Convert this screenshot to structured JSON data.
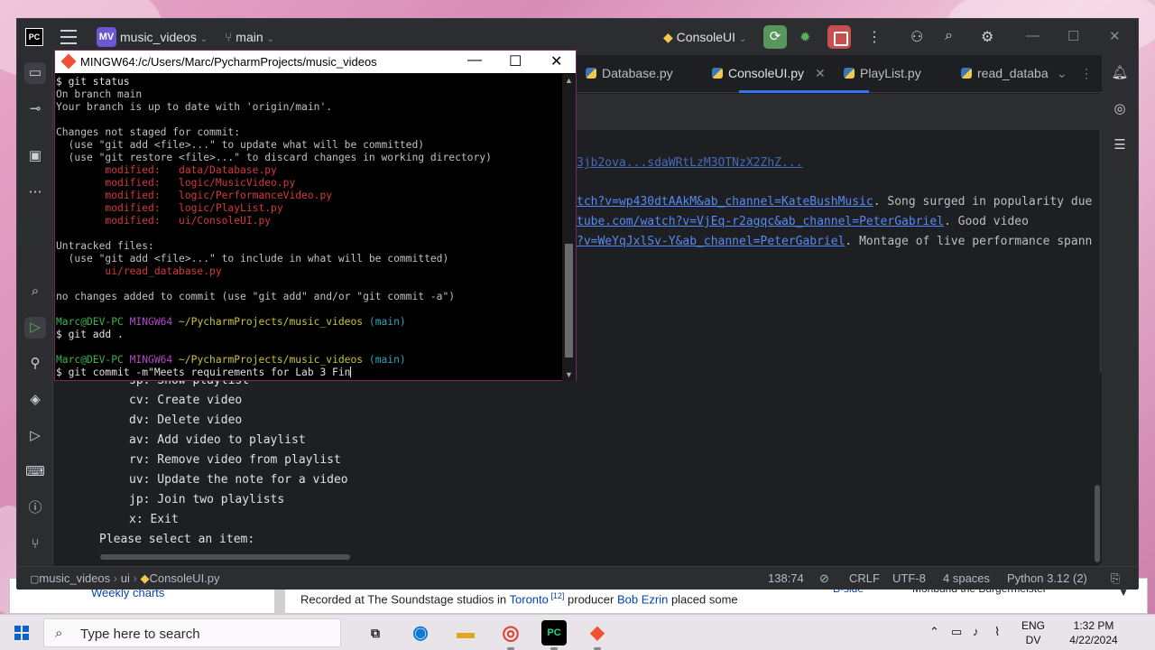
{
  "browser": {
    "weekly_charts": "Weekly charts",
    "recorded_text_1": "Recorded at The Soundstage studios in ",
    "toronto": "Toronto",
    "ref": " [12]",
    "recorded_text_2": " producer ",
    "bob_ezrin": "Bob Ezrin",
    "recorded_text_3": " placed some",
    "bside": "B-side",
    "bside_value": "Moribund the Burgermeister"
  },
  "ide": {
    "logo": "PC",
    "project_badge": "MV",
    "project_name": "music_videos",
    "branch": "main",
    "run_config": "ConsoleUI",
    "tabs": [
      {
        "label": "Database.py"
      },
      {
        "label": "ConsoleUI.py",
        "active": true
      },
      {
        "label": "PlayList.py"
      },
      {
        "label": "read_databa"
      }
    ],
    "editor_lines": [
      {
        "pre": "",
        "url": "3jb2ova...sdaWRtLzM3OTNzX2ZhZ...",
        "post": ""
      },
      {
        "pre": "",
        "url": "tch?v=wp430dtAAkM&ab_channel=KateBushMusic",
        "post": ". Song surged in popularity due"
      },
      {
        "pre": "",
        "url": "tube.com/watch?v=VjEq-r2agqc&ab_channel=PeterGabriel",
        "post": ". Good video"
      },
      {
        "pre": "",
        "url": "?v=WeYqJxlSv-Y&ab_channel=PeterGabriel",
        "post": ". Montage of live performance spann"
      }
    ],
    "console_menu": [
      "sp: Show playlist",
      "cv: Create video",
      "dv: Delete video",
      "av: Add video to playlist",
      "rv: Remove video from playlist",
      "uv: Update the note for a video",
      "jp: Join two playlists",
      "x: Exit"
    ],
    "console_prompt": "Please select an item:",
    "status": {
      "breadcrumb_project": "music_videos",
      "breadcrumb_folder": "ui",
      "breadcrumb_file": "ConsoleUI.py",
      "position": "138:74",
      "line_ending": "CRLF",
      "encoding": "UTF-8",
      "indent": "4 spaces",
      "interpreter": "Python 3.12 (2)"
    }
  },
  "terminal": {
    "title": "MINGW64:/c/Users/Marc/PycharmProjects/music_videos",
    "lines": [
      {
        "segs": [
          {
            "c": "wht",
            "t": "$ git status"
          }
        ]
      },
      {
        "segs": [
          {
            "c": "",
            "t": "On branch main"
          }
        ]
      },
      {
        "segs": [
          {
            "c": "",
            "t": "Your branch is up to date with 'origin/main'."
          }
        ]
      },
      {
        "segs": [
          {
            "c": "",
            "t": ""
          }
        ]
      },
      {
        "segs": [
          {
            "c": "",
            "t": "Changes not staged for commit:"
          }
        ]
      },
      {
        "segs": [
          {
            "c": "",
            "t": "  (use \"git add <file>...\" to update what will be committed)"
          }
        ]
      },
      {
        "segs": [
          {
            "c": "",
            "t": "  (use \"git restore <file>...\" to discard changes in working directory)"
          }
        ]
      },
      {
        "segs": [
          {
            "c": "red",
            "t": "        modified:   data/Database.py"
          }
        ]
      },
      {
        "segs": [
          {
            "c": "red",
            "t": "        modified:   logic/MusicVideo.py"
          }
        ]
      },
      {
        "segs": [
          {
            "c": "red",
            "t": "        modified:   logic/PerformanceVideo.py"
          }
        ]
      },
      {
        "segs": [
          {
            "c": "red",
            "t": "        modified:   logic/PlayList.py"
          }
        ]
      },
      {
        "segs": [
          {
            "c": "red",
            "t": "        modified:   ui/ConsoleUI.py"
          }
        ]
      },
      {
        "segs": [
          {
            "c": "",
            "t": ""
          }
        ]
      },
      {
        "segs": [
          {
            "c": "",
            "t": "Untracked files:"
          }
        ]
      },
      {
        "segs": [
          {
            "c": "",
            "t": "  (use \"git add <file>...\" to include in what will be committed)"
          }
        ]
      },
      {
        "segs": [
          {
            "c": "red",
            "t": "        ui/read_database.py"
          }
        ]
      },
      {
        "segs": [
          {
            "c": "",
            "t": ""
          }
        ]
      },
      {
        "segs": [
          {
            "c": "",
            "t": "no changes added to commit (use \"git add\" and/or \"git commit -a\")"
          }
        ]
      },
      {
        "segs": [
          {
            "c": "",
            "t": ""
          }
        ]
      },
      {
        "segs": [
          {
            "c": "grn",
            "t": "Marc@DEV-PC "
          },
          {
            "c": "mag",
            "t": "MINGW64 "
          },
          {
            "c": "yel",
            "t": "~/PycharmProjects/music_videos "
          },
          {
            "c": "cyn",
            "t": "(main)"
          }
        ]
      },
      {
        "segs": [
          {
            "c": "wht",
            "t": "$ git add ."
          }
        ]
      },
      {
        "segs": [
          {
            "c": "",
            "t": ""
          }
        ]
      },
      {
        "segs": [
          {
            "c": "grn",
            "t": "Marc@DEV-PC "
          },
          {
            "c": "mag",
            "t": "MINGW64 "
          },
          {
            "c": "yel",
            "t": "~/PycharmProjects/music_videos "
          },
          {
            "c": "cyn",
            "t": "(main)"
          }
        ]
      },
      {
        "segs": [
          {
            "c": "wht",
            "t": "$ git commit -m\"Meets requirements for Lab 3 Fin"
          }
        ],
        "cursor": true
      }
    ]
  },
  "taskbar": {
    "search_placeholder": "Type here to search",
    "lang_top": "ENG",
    "lang_bottom": "DV",
    "time": "1:32 PM",
    "date": "4/22/2024"
  },
  "colors": {
    "accent": "#3574f0",
    "run_green": "#57965c",
    "stop_red": "#c94f4f",
    "terminal_red": "#d23a3a",
    "terminal_green": "#39b54a"
  }
}
